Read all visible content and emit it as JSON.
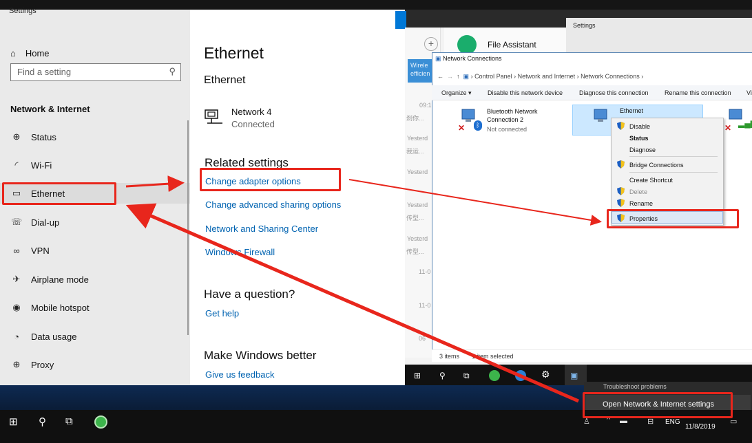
{
  "settings": {
    "window_title": "Settings",
    "home": "Home",
    "search_placeholder": "Find a setting",
    "section": "Network & Internet",
    "nav": [
      "Status",
      "Wi-Fi",
      "Ethernet",
      "Dial-up",
      "VPN",
      "Airplane mode",
      "Mobile hotspot",
      "Data usage",
      "Proxy"
    ],
    "selected": "Ethernet",
    "page_title": "Ethernet",
    "subtitle": "Ethernet",
    "network_name": "Network 4",
    "network_status": "Connected",
    "related_heading": "Related settings",
    "links": [
      "Change adapter options",
      "Change advanced sharing options",
      "Network and Sharing Center",
      "Windows Firewall"
    ],
    "question_heading": "Have a question?",
    "question_link": "Get help",
    "better_heading": "Make Windows better",
    "better_link": "Give us feedback"
  },
  "chat_app": {
    "contact": "File Assistant",
    "card_text": "Wirele efficien",
    "second_settings_title": "Settings",
    "times": [
      "09:1",
      "Yesterd",
      "Yesterd",
      "Yesterd",
      "Yesterd",
      "11-0",
      "11-0",
      "06"
    ],
    "snippets": [
      "刹你...",
      "我运...",
      "传型...",
      "传型..."
    ]
  },
  "network_connections": {
    "title": "Network Connections",
    "breadcrumb": [
      "Control Panel",
      "Network and Internet",
      "Network Connections"
    ],
    "toolbar": [
      "Organize ▾",
      "Disable this network device",
      "Diagnose this connection",
      "Rename this connection",
      "Vi"
    ],
    "items": [
      {
        "name": "Bluetooth Network Connection 2",
        "status": "Not connected"
      },
      {
        "name": "Ethernet",
        "status": ""
      }
    ],
    "status_bar": [
      "3 items",
      "1 item selected"
    ]
  },
  "context_menu": {
    "items": [
      {
        "label": "Disable",
        "style": "normal"
      },
      {
        "label": "Status",
        "style": "bold"
      },
      {
        "label": "Diagnose",
        "style": "normal"
      },
      {
        "label": "Bridge Connections",
        "style": "normal"
      },
      {
        "label": "Create Shortcut",
        "style": "normal"
      },
      {
        "label": "Delete",
        "style": "disabled"
      },
      {
        "label": "Rename",
        "style": "normal"
      },
      {
        "label": "Properties",
        "style": "highlight"
      }
    ]
  },
  "popup": {
    "top_text": "Troubleshoot problems",
    "open_button": "Open Network & Internet settings"
  },
  "taskbar": {
    "language": "ENG",
    "date": "11/8/2019"
  },
  "colors": {
    "accent": "#0063b1",
    "annotation": "#e8261c",
    "highlight": "#cce8ff"
  }
}
